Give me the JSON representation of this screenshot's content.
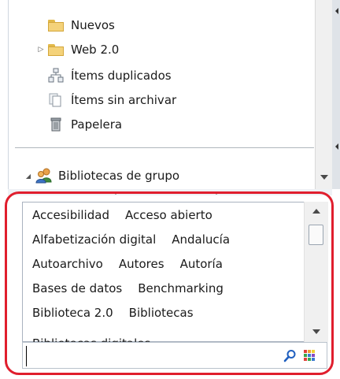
{
  "tree": {
    "items": [
      {
        "label": "Nuevos",
        "icon": "folder-icon"
      },
      {
        "label": "Web 2.0",
        "icon": "folder-icon",
        "expander": "▷"
      },
      {
        "label": "Ítems duplicados",
        "icon": "duplicate-items-icon"
      },
      {
        "label": "Ítems sin archivar",
        "icon": "unfiled-items-icon"
      },
      {
        "label": "Papelera",
        "icon": "trash-icon"
      }
    ],
    "group_libraries": {
      "label": "Bibliotecas de grupo",
      "expander": "◢",
      "icon": "group-icon"
    }
  },
  "tag_selector": {
    "rows": [
      [
        "Accesibilidad",
        "Acceso abierto"
      ],
      [
        "Alfabetización digital",
        "Andalucía"
      ],
      [
        "Autoarchivo",
        "Autores",
        "Autoría"
      ],
      [
        "Bases de datos",
        "Benchmarking"
      ],
      [
        "Biblioteca 2.0",
        "Bibliotecas"
      ]
    ],
    "partial_row": "Bibliotecas digitales",
    "filter": {
      "value": "",
      "placeholder": ""
    }
  },
  "colors": {
    "highlight": "#e01e2d",
    "folder": "#f4d27a",
    "accent": "#1f5fbf"
  }
}
